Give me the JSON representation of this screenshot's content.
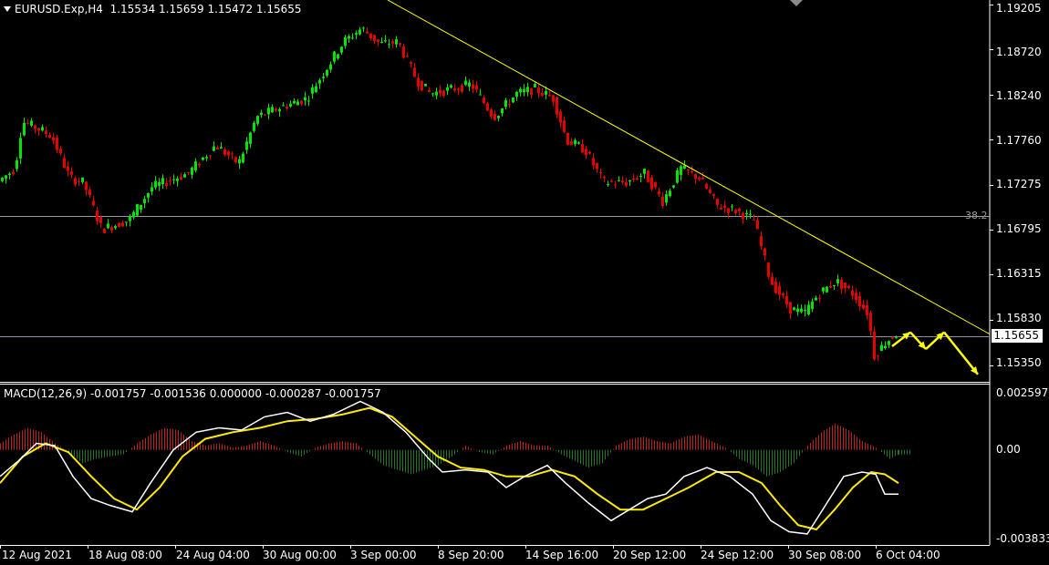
{
  "header": {
    "symbol": "EURUSD.Exp,H4",
    "ohlc": "1.15534 1.15659 1.15472 1.15655"
  },
  "macd": {
    "label": "MACD(12,26,9) -0.001757 -0.001536 0.000000 -0.000287 -0.001757",
    "ticks": [
      "0.002597",
      "0.00",
      "-0.003833"
    ]
  },
  "price_axis": {
    "ticks": [
      "1.19205",
      "1.18720",
      "1.18240",
      "1.17760",
      "1.17275",
      "1.16795",
      "1.16315",
      "1.15830",
      "1.15350"
    ],
    "current_price": "1.15655"
  },
  "fib_label": "38.2",
  "time_axis": {
    "ticks": [
      "12 Aug 2021",
      "18 Aug 08:00",
      "24 Aug 04:00",
      "30 Aug 00:00",
      "3 Sep 00:00",
      "8 Sep 20:00",
      "14 Sep 16:00",
      "20 Sep 12:00",
      "24 Sep 12:00",
      "30 Sep 08:00",
      "6 Oct 04:00"
    ]
  },
  "colors": {
    "bull": "#00e600",
    "bear": "#e60000",
    "trendline": "#ffff00",
    "signal": "#ffea00",
    "macd_line": "#ffffff",
    "hist_pos": "#c02020",
    "hist_neg": "#1e7a1e",
    "grid": "#9a9a9a"
  },
  "chart_data": {
    "type": "candlestick",
    "symbol": "EURUSD.Exp",
    "timeframe": "H4",
    "ylim": [
      1.1517,
      1.1925
    ],
    "price_path": [
      [
        0,
        1.173
      ],
      [
        20,
        1.1745
      ],
      [
        28,
        1.1795
      ],
      [
        40,
        1.179
      ],
      [
        60,
        1.178
      ],
      [
        80,
        1.1735
      ],
      [
        95,
        1.173
      ],
      [
        115,
        1.168
      ],
      [
        145,
        1.169
      ],
      [
        170,
        1.1725
      ],
      [
        210,
        1.174
      ],
      [
        240,
        1.177
      ],
      [
        265,
        1.175
      ],
      [
        285,
        1.18
      ],
      [
        310,
        1.181
      ],
      [
        340,
        1.182
      ],
      [
        360,
        1.185
      ],
      [
        380,
        1.188
      ],
      [
        400,
        1.1895
      ],
      [
        420,
        1.1878
      ],
      [
        440,
        1.188
      ],
      [
        460,
        1.184
      ],
      [
        475,
        1.1825
      ],
      [
        500,
        1.183
      ],
      [
        520,
        1.1835
      ],
      [
        545,
        1.18
      ],
      [
        570,
        1.1825
      ],
      [
        590,
        1.183
      ],
      [
        610,
        1.182
      ],
      [
        625,
        1.1775
      ],
      [
        645,
        1.1765
      ],
      [
        665,
        1.173
      ],
      [
        690,
        1.173
      ],
      [
        710,
        1.174
      ],
      [
        730,
        1.171
      ],
      [
        750,
        1.1745
      ],
      [
        770,
        1.1735
      ],
      [
        790,
        1.1705
      ],
      [
        810,
        1.17
      ],
      [
        830,
        1.169
      ],
      [
        848,
        1.1625
      ],
      [
        870,
        1.1595
      ],
      [
        885,
        1.159
      ],
      [
        900,
        1.161
      ],
      [
        920,
        1.1625
      ],
      [
        940,
        1.161
      ],
      [
        955,
        1.159
      ],
      [
        962,
        1.1545
      ],
      [
        975,
        1.156
      ],
      [
        985,
        1.1568
      ]
    ],
    "trendline": {
      "from": [
        425,
        1.1925
      ],
      "to": [
        1085,
        1.1568
      ]
    },
    "fib_level": {
      "label": "38.2",
      "price": 1.16945
    },
    "current_price": 1.15655,
    "forecast_arrows": [
      [
        978,
        1.1555
      ],
      [
        998,
        1.157
      ],
      [
        1015,
        1.1552
      ],
      [
        1035,
        1.157
      ],
      [
        1072,
        1.1525
      ]
    ],
    "macd": {
      "ylim": [
        -0.0043,
        0.003
      ],
      "macd_line": [
        [
          0,
          -0.0012
        ],
        [
          20,
          -0.0005
        ],
        [
          40,
          0.0003
        ],
        [
          60,
          0.0002
        ],
        [
          80,
          -0.0012
        ],
        [
          100,
          -0.0022
        ],
        [
          120,
          -0.0025
        ],
        [
          145,
          -0.0028
        ],
        [
          165,
          -0.0015
        ],
        [
          190,
          0.0
        ],
        [
          215,
          0.0008
        ],
        [
          240,
          0.001
        ],
        [
          265,
          0.0009
        ],
        [
          290,
          0.0015
        ],
        [
          315,
          0.0017
        ],
        [
          340,
          0.0013
        ],
        [
          365,
          0.0016
        ],
        [
          395,
          0.0022
        ],
        [
          420,
          0.0017
        ],
        [
          445,
          0.0008
        ],
        [
          470,
          -0.0004
        ],
        [
          485,
          -0.001
        ],
        [
          510,
          -0.0009
        ],
        [
          535,
          -0.001
        ],
        [
          555,
          -0.0017
        ],
        [
          575,
          -0.0012
        ],
        [
          600,
          -0.0007
        ],
        [
          620,
          -0.0015
        ],
        [
          645,
          -0.0024
        ],
        [
          670,
          -0.0032
        ],
        [
          690,
          -0.0027
        ],
        [
          710,
          -0.0022
        ],
        [
          730,
          -0.002
        ],
        [
          750,
          -0.0012
        ],
        [
          775,
          -0.0008
        ],
        [
          800,
          -0.0012
        ],
        [
          825,
          -0.002
        ],
        [
          845,
          -0.0032
        ],
        [
          865,
          -0.0037
        ],
        [
          885,
          -0.0038
        ],
        [
          905,
          -0.0025
        ],
        [
          925,
          -0.0012
        ],
        [
          945,
          -0.001
        ],
        [
          960,
          -0.0011
        ],
        [
          970,
          -0.002
        ],
        [
          985,
          -0.002
        ]
      ],
      "signal_line": [
        [
          0,
          -0.0015
        ],
        [
          25,
          -0.0003
        ],
        [
          50,
          0.0003
        ],
        [
          75,
          -0.0001
        ],
        [
          100,
          -0.0012
        ],
        [
          125,
          -0.0022
        ],
        [
          150,
          -0.0027
        ],
        [
          175,
          -0.0017
        ],
        [
          200,
          -0.0003
        ],
        [
          225,
          0.0005
        ],
        [
          255,
          0.0008
        ],
        [
          285,
          0.001
        ],
        [
          315,
          0.0013
        ],
        [
          345,
          0.0014
        ],
        [
          375,
          0.0016
        ],
        [
          405,
          0.0019
        ],
        [
          430,
          0.0015
        ],
        [
          455,
          0.0006
        ],
        [
          480,
          -0.0003
        ],
        [
          505,
          -0.0008
        ],
        [
          530,
          -0.0009
        ],
        [
          555,
          -0.0012
        ],
        [
          580,
          -0.0012
        ],
        [
          605,
          -0.0009
        ],
        [
          630,
          -0.0012
        ],
        [
          655,
          -0.002
        ],
        [
          680,
          -0.0027
        ],
        [
          705,
          -0.0027
        ],
        [
          730,
          -0.0022
        ],
        [
          755,
          -0.0017
        ],
        [
          785,
          -0.001
        ],
        [
          810,
          -0.001
        ],
        [
          835,
          -0.0015
        ],
        [
          855,
          -0.0025
        ],
        [
          875,
          -0.0034
        ],
        [
          895,
          -0.0036
        ],
        [
          915,
          -0.0027
        ],
        [
          935,
          -0.0017
        ],
        [
          955,
          -0.001
        ],
        [
          970,
          -0.0011
        ],
        [
          985,
          -0.0015
        ]
      ],
      "histogram": [
        [
          0,
          0.0003
        ],
        [
          15,
          0.0007
        ],
        [
          30,
          0.001
        ],
        [
          45,
          0.0008
        ],
        [
          60,
          0.0003
        ],
        [
          75,
          -0.0001
        ],
        [
          90,
          -0.0006
        ],
        [
          105,
          -0.0004
        ],
        [
          120,
          -0.0003
        ],
        [
          135,
          -0.0002
        ],
        [
          150,
          0.0003
        ],
        [
          165,
          0.0007
        ],
        [
          180,
          0.001
        ],
        [
          195,
          0.0009
        ],
        [
          210,
          0.0004
        ],
        [
          225,
          0.0002
        ],
        [
          240,
          0.0003
        ],
        [
          255,
          0.0001
        ],
        [
          270,
          0.0002
        ],
        [
          285,
          0.0004
        ],
        [
          300,
          0.0002
        ],
        [
          315,
          -0.0001
        ],
        [
          330,
          -0.0003
        ],
        [
          345,
          0.0001
        ],
        [
          360,
          0.0003
        ],
        [
          375,
          0.0004
        ],
        [
          390,
          0.0003
        ],
        [
          405,
          -0.0002
        ],
        [
          420,
          -0.0007
        ],
        [
          435,
          -0.0009
        ],
        [
          450,
          -0.0011
        ],
        [
          465,
          -0.0009
        ],
        [
          480,
          -0.0007
        ],
        [
          495,
          -0.0003
        ],
        [
          510,
          0.0002
        ],
        [
          525,
          -0.0001
        ],
        [
          540,
          -0.0002
        ],
        [
          555,
          0.0002
        ],
        [
          570,
          0.0004
        ],
        [
          585,
          0.0002
        ],
        [
          600,
          0.0002
        ],
        [
          615,
          -0.0002
        ],
        [
          630,
          -0.0005
        ],
        [
          645,
          -0.0008
        ],
        [
          660,
          -0.0006
        ],
        [
          675,
          0.0002
        ],
        [
          690,
          0.0005
        ],
        [
          705,
          0.0006
        ],
        [
          720,
          0.0004
        ],
        [
          735,
          0.0003
        ],
        [
          750,
          0.0006
        ],
        [
          765,
          0.0007
        ],
        [
          780,
          0.0004
        ],
        [
          795,
          0.0001
        ],
        [
          810,
          -0.0004
        ],
        [
          825,
          -0.0007
        ],
        [
          840,
          -0.0012
        ],
        [
          855,
          -0.001
        ],
        [
          870,
          -0.0006
        ],
        [
          885,
          0.0002
        ],
        [
          900,
          0.0008
        ],
        [
          915,
          0.0012
        ],
        [
          930,
          0.0009
        ],
        [
          945,
          0.0004
        ],
        [
          960,
          0.0001
        ],
        [
          975,
          -0.0004
        ],
        [
          985,
          -0.0002
        ]
      ]
    }
  }
}
